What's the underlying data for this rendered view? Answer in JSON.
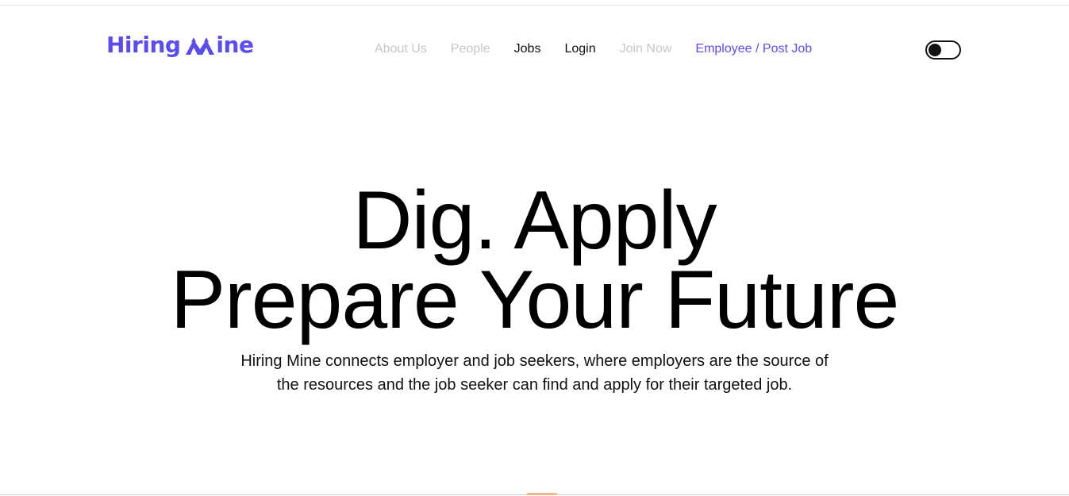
{
  "brand": {
    "name_part1": "Hiring",
    "name_part2": "ine",
    "accent_color": "#5b4cf0",
    "logo_icon": "mountain-m-icon"
  },
  "nav": {
    "items": [
      {
        "label": "About Us",
        "style": "muted"
      },
      {
        "label": "People",
        "style": "muted"
      },
      {
        "label": "Jobs",
        "style": "dark"
      },
      {
        "label": "Login",
        "style": "dark"
      },
      {
        "label": "Join Now",
        "style": "muted"
      },
      {
        "label": "Employee / Post Job",
        "style": "accent"
      }
    ]
  },
  "theme_toggle": {
    "state": "off"
  },
  "hero": {
    "headline_line1": "Dig. Apply",
    "headline_line2": "Prepare Your Future",
    "description": "Hiring Mine connects employer and job seekers, where employers are the source of the resources and the job seeker can find and apply for their targeted job."
  },
  "colors": {
    "accent": "#5b4cf0",
    "muted_nav": "#c6c6cc",
    "text": "#111111"
  }
}
